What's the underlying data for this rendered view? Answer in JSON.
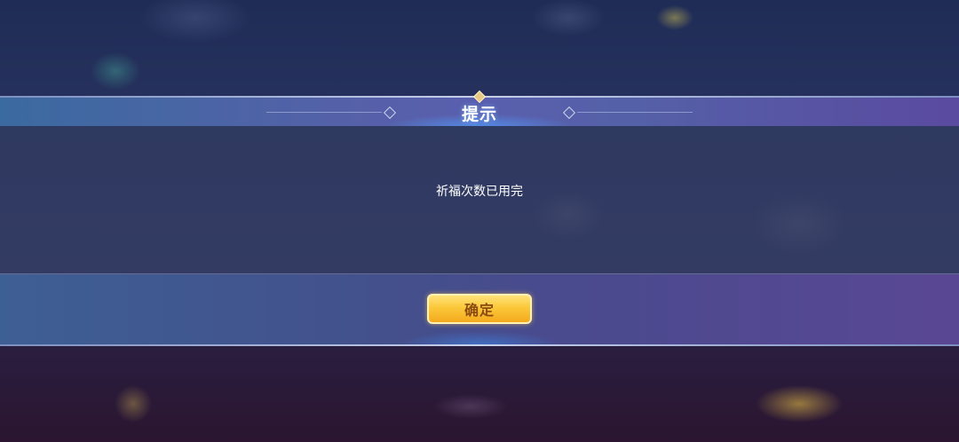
{
  "dialog": {
    "title": "提示",
    "message": "祈福次数已用完",
    "confirm_label": "确定"
  },
  "colors": {
    "header_bar": "#5461a8",
    "body_background": "#333b62",
    "confirm_button": "#fbc83a",
    "confirm_text": "#8a4a12"
  }
}
